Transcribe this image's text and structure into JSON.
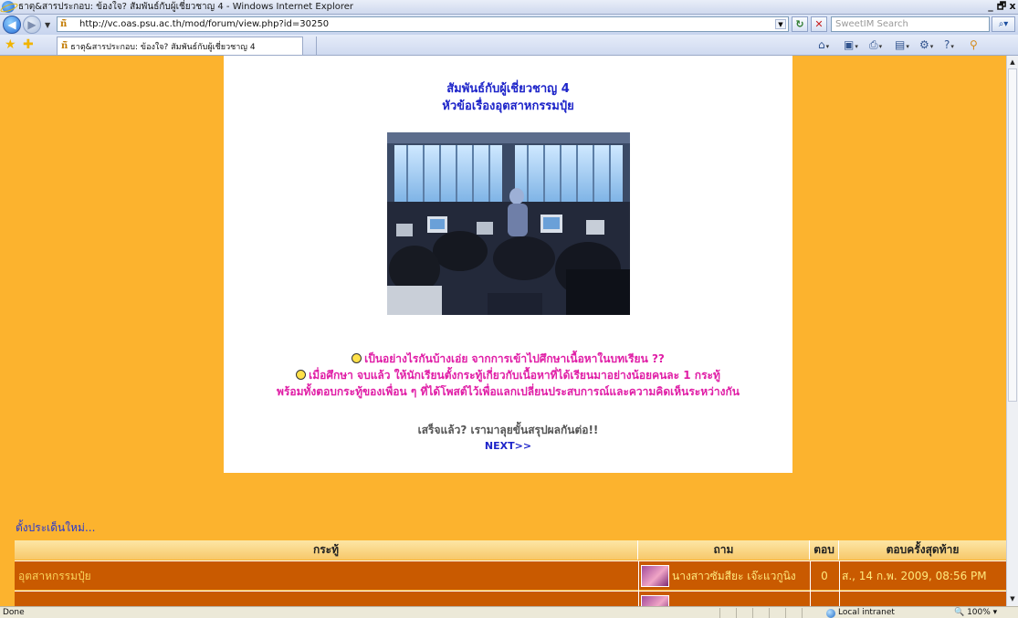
{
  "window": {
    "title": "ธาตุ&สารประกอบ: ข้องใจ? สัมพันธ์กับผู้เชี่ยวชาญ 4 - Windows Internet Explorer",
    "min": "_",
    "max": "🗗",
    "close": "x"
  },
  "address": {
    "url": "http://vc.oas.psu.ac.th/mod/forum/view.php?id=30250",
    "search_placeholder": "SweetIM Search"
  },
  "tab": {
    "title": "ธาตุ&สารประกอบ: ข้องใจ? สัมพันธ์กับผู้เชี่ยวชาญ 4"
  },
  "content": {
    "heading1": "สัมพันธ์กับผู้เชี่ยวชาญ 4",
    "heading2": "หัวข้อเรื่องอุตสาหกรรมปุ๋ย",
    "line1": "เป็นอย่างไรกันบ้างเอ่ย จากการเข้าไปศึกษาเนื้อหาในบทเรียน ??",
    "line2": "เมื่อศึกษา จบแล้ว ให้นักเรียนตั้งกระทู้เกี่ยวกับเนื้อหาที่ได้เรียนมาอย่างน้อยคนละ 1 กระทู้",
    "line3": "พร้อมทั้งตอบกระทู้ของเพื่อน ๆ ที่ได้โพสต์ไว้เพื่อแลกเปลี่ยนประสบการณ์และความคิดเห็นระหว่างกัน",
    "done_text": "เสร็จแล้ว? เรามาลุยขั้นสรุปผลกันต่อ!!",
    "next_link": "NEXT>>"
  },
  "forum": {
    "new_topic": "ตั้งประเด็นใหม่...",
    "headers": {
      "topic": "กระทู้",
      "asker": "ถาม",
      "replies": "ตอบ",
      "last_reply": "ตอบครั้งสุดท้าย"
    },
    "rows": [
      {
        "topic": "อุตสาหกรรมปุ๋ย",
        "asker": "นางสาวซัมสียะ เจ๊ะแวกูนิง",
        "replies": "0",
        "last_reply": "ส., 14 ก.พ. 2009, 08:56 PM"
      }
    ]
  },
  "status": {
    "text": "Done",
    "zone": "Local intranet",
    "zoom": "100%"
  }
}
